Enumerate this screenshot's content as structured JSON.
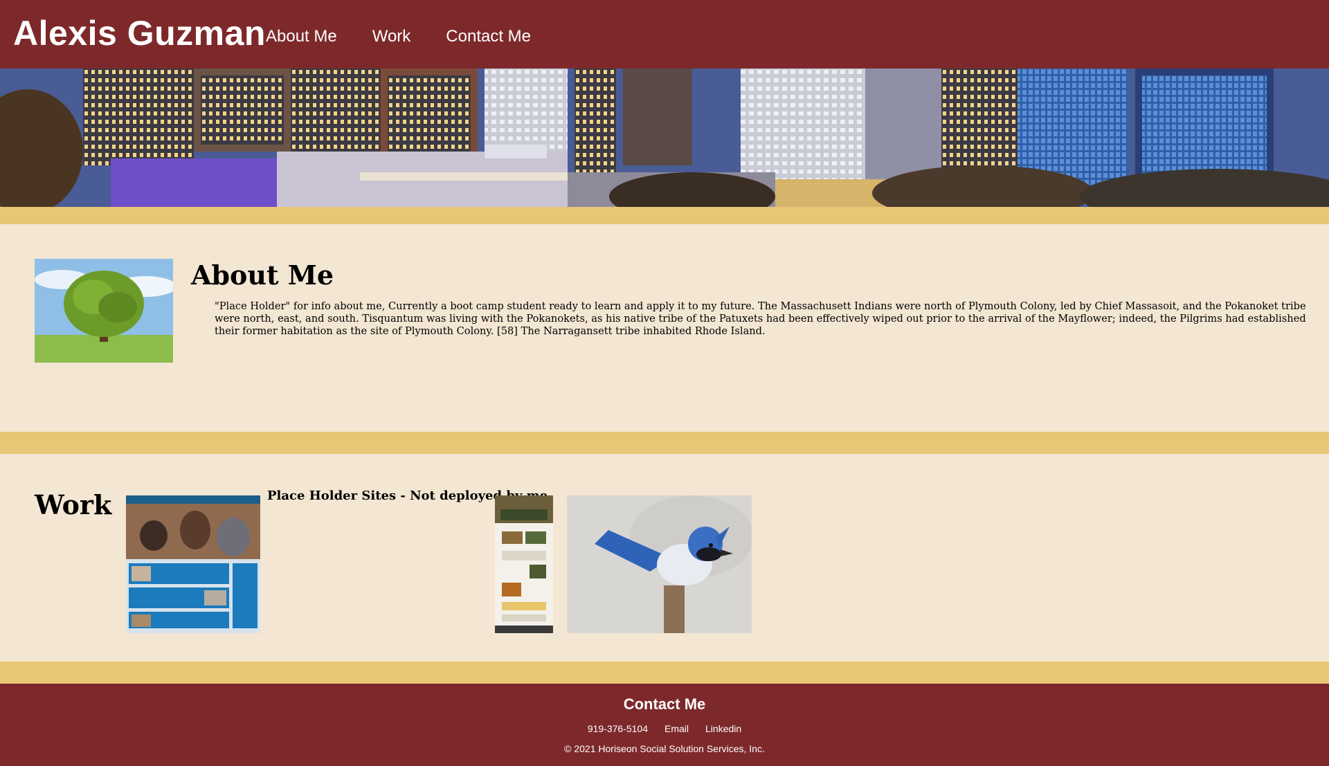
{
  "header": {
    "brand": "Alexis Guzman",
    "nav": [
      "About Me",
      "Work",
      "Contact Me"
    ]
  },
  "about": {
    "title": "About Me",
    "text": "\"Place Holder\" for info about me, Currently a boot camp student ready to learn and apply it to my future. The Massachusett Indians were north of Plymouth Colony, led by Chief Massasoit, and the Pokanoket tribe were north, east, and south. Tisquantum was living with the Pokanokets, as his native tribe of the Patuxets had been effectively wiped out prior to the arrival of the Mayflower; indeed, the Pilgrims had established their former habitation as the site of Plymouth Colony. [58] The Narragansett tribe inhabited Rhode Island."
  },
  "work": {
    "title": "Work",
    "caption": "Place Holder Sites - Not deployed by me"
  },
  "footer": {
    "title": "Contact Me",
    "links": [
      "919-376-5104",
      "Email",
      "Linkedin"
    ],
    "copyright": "© 2021 Horiseon Social Solution Services, Inc."
  },
  "colors": {
    "header_bg": "#7d292b",
    "content_bg": "#f3e6d2",
    "band": "#e9c676"
  }
}
